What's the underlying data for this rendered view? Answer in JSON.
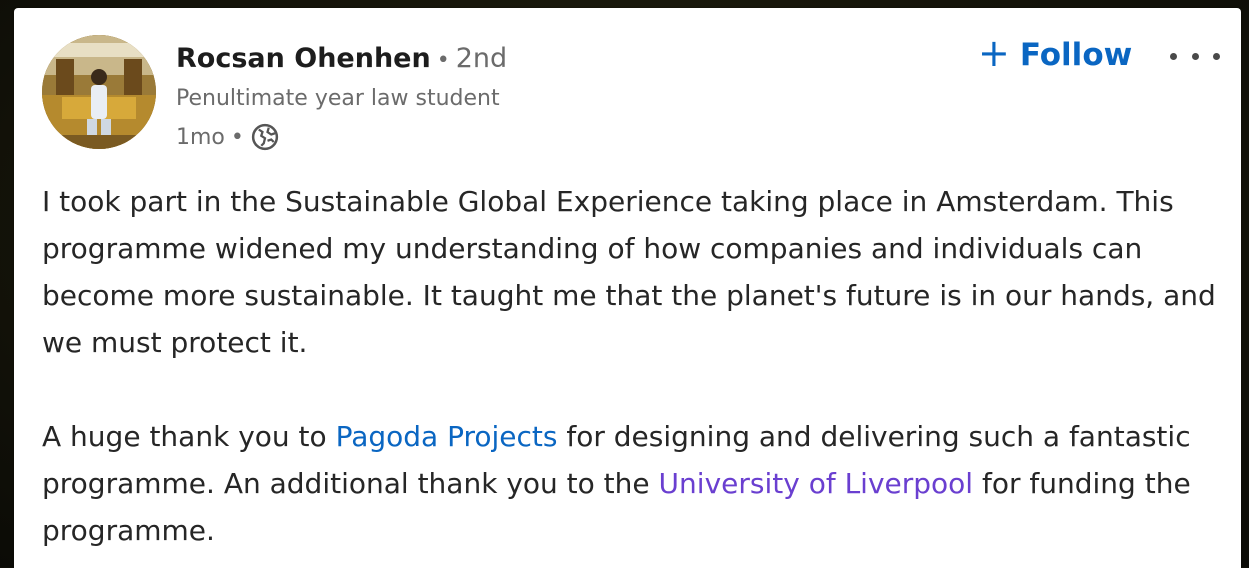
{
  "author": {
    "name": "Rocsan Ohenhen",
    "separator": "•",
    "degree": "2nd",
    "headline": "Penultimate year law student",
    "time_ago": "1mo",
    "meta_separator": "•",
    "visibility_icon": "globe-icon"
  },
  "actions": {
    "follow_label": "Follow",
    "follow_icon": "plus-icon",
    "more_icon": "more-options-icon"
  },
  "post": {
    "paragraph1": "I took part in the Sustainable Global Experience taking place in Amsterdam. This programme widened my understanding of how companies and individuals can become more sustainable. It taught me that the planet's future is in our hands, and we must protect it.",
    "paragraph2_part1": "A huge thank you to ",
    "mention1": "Pagoda Projects",
    "paragraph2_part2": " for designing and delivering such a fantastic programme. An additional thank you to the ",
    "mention2": "University of Liverpool",
    "paragraph2_part3": " for funding the programme."
  },
  "colors": {
    "link_blue": "#0a66c2",
    "link_purple": "#6a3fd0",
    "muted_text": "#6b6b6b",
    "body_text": "#262626"
  }
}
